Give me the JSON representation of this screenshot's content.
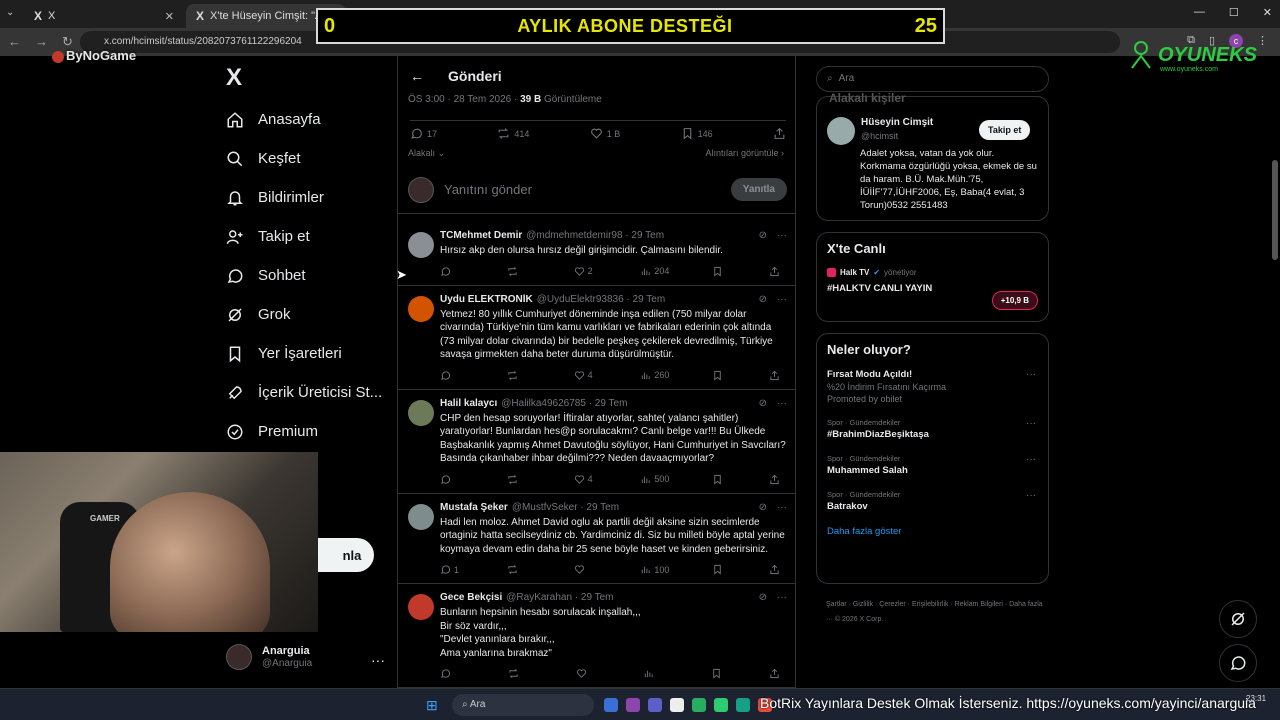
{
  "browser": {
    "tabs": [
      {
        "label": "X",
        "favicon": "X"
      },
      {
        "label": "X'te Hüseyin Cimşit: \"Alın size",
        "favicon": "X"
      }
    ],
    "new_tab": "+",
    "url": "x.com/hcimsit/status/2082073761122296204"
  },
  "overlay": {
    "title": "AYLIK ABONE DESTEĞI",
    "left_count": "0",
    "right_count": "25",
    "brand_left": "ByNoGame",
    "brand_right": "OYUNEKS",
    "brand_right_sub": "www.oyuneks.com"
  },
  "sidebar": {
    "logo": "X",
    "items": [
      {
        "label": "Anasayfa",
        "icon": "home-icon"
      },
      {
        "label": "Keşfet",
        "icon": "search-icon"
      },
      {
        "label": "Bildirimler",
        "icon": "bell-icon"
      },
      {
        "label": "Takip et",
        "icon": "person-add-icon"
      },
      {
        "label": "Sohbet",
        "icon": "chat-icon"
      },
      {
        "label": "Grok",
        "icon": "grok-icon"
      },
      {
        "label": "Yer İşaretleri",
        "icon": "bookmark-icon"
      },
      {
        "label": "İçerik Üreticisi St...",
        "icon": "rocket-icon"
      },
      {
        "label": "Premium",
        "icon": "verified-icon"
      }
    ],
    "post_button": "nla",
    "profile": {
      "name": "Anarguia",
      "handle": "@Anarguia",
      "more": "···"
    }
  },
  "webcam": {
    "label": "GAMER"
  },
  "post": {
    "header": "Gönderi",
    "time": "ÖS 3:00 · 28 Tem 2026 · ",
    "views": "39 B",
    "views_label": " Görüntüleme",
    "stats": {
      "replies": "17",
      "reposts": "414",
      "likes": "1 B",
      "bookmarks": "146"
    },
    "sort": "Alakalı",
    "quotes": "Alıntıları görüntüle ›",
    "reply_placeholder": "Yanıtını gönder",
    "reply_button": "Yanıtla"
  },
  "tweets": [
    {
      "name": "TCMehmet Demir",
      "handle": "@mdmehmetdemir98 · 29 Tem",
      "text": "Hırsız akp den olursa hırsız değil girişimcidir. Çalmasını bilendir.",
      "replies": "",
      "reposts": "",
      "likes": "2",
      "views": "204",
      "avatar": "#8a8f96"
    },
    {
      "name": "Uydu ELEKTRONİK",
      "handle": "@UyduElektr93836 · 29 Tem",
      "text": "Yetmez! 80 yıllık Cumhuriyet döneminde inşa edilen (750 milyar dolar civarında) Türkiye'nin tüm kamu varlıkları ve fabrikaları ederinin çok altında (73 milyar dolar civarında) bir bedelle peşkeş çekilerek devredilmiş, Türkiye savaşa girmekten daha beter duruma düşürülmüştür.",
      "replies": "",
      "reposts": "",
      "likes": "4",
      "views": "260",
      "avatar": "#d35400"
    },
    {
      "name": "Halil kalaycı",
      "handle": "@Halilka49626785 · 29 Tem",
      "text": "CHP den hesap soruyorlar! İftiralar atıyorlar, sahte( yalancı şahitler) yaratıyorlar! Bunlardan hes@p sorulacakmı? Canlı belge var!!! Bu Ülkede Başbakanlık yapmış Ahmet Davutoğlu söylüyor, Hani Cumhuriyet in Savcıları? Basında çıkanhaber ihbar değilmi??? Neden davaaçmıyorlar?",
      "replies": "",
      "reposts": "",
      "likes": "4",
      "views": "500",
      "avatar": "#6d7a5a"
    },
    {
      "name": "Mustafa Şeker",
      "handle": "@MustfvSeker · 29 Tem",
      "text": "Hadi len moloz.  Ahmet David oglu ak partili değil aksine sizin secimlerde ortaginiz hatta secilseydiniz cb. Yardimciniz di.  Siz bu milleti böyle aptal yerine koymaya devam edin daha bir 25 sene böyle haset ve kinden geberirsiniz.",
      "replies": "1",
      "reposts": "",
      "likes": "",
      "views": "100",
      "avatar": "#7f8c8d"
    },
    {
      "name": "Gece Bekçisi",
      "handle": "@RayKarahan · 29 Tem",
      "text": "Bunların hepsinin hesabı sorulacak inşallah,,,\nBir söz vardır,,,\n\"Devlet yanınlara bırakır,,,\nAma yanlarına bırakmaz\"",
      "replies": "",
      "reposts": "",
      "likes": "",
      "views": "",
      "avatar": "#c0392b"
    }
  ],
  "right": {
    "search_placeholder": "Ara",
    "who_title_cut": "Alakalı kişiler",
    "who": {
      "name": "Hüseyin Cimşit",
      "handle": "@hcimsit",
      "follow": "Takip et",
      "bio": "Adalet yoksa, vatan da yok olur. Korkmama özgürlüğü yoksa, ekmek de su da haram. B.Ü. Mak.Müh.'75, İÜİİF'77,İÜHF2006, Eş, Baba(4 evlat, 3 Torun)0532 2551483"
    },
    "live": {
      "title": "X'te Canlı",
      "source": "Halk TV",
      "source_note": "yönetiyor",
      "stream": "#HALKTV CANLI YAYIN",
      "count": "+10,9 B"
    },
    "trends": {
      "title": "Neler oluyor?",
      "items": [
        {
          "cat": "",
          "topic": "Fırsat Modu Açıldı!",
          "sub": "%20 İndirim Fırsatını Kaçırma",
          "promo": "Promoted by obilet"
        },
        {
          "cat": "Spor · Gündemdekiler",
          "topic": "#BrahimDiazBeşiktaşa",
          "sub": "",
          "promo": ""
        },
        {
          "cat": "Spor · Gündemdekiler",
          "topic": "Muhammed Salah",
          "sub": "",
          "promo": ""
        },
        {
          "cat": "Spor · Gündemdekiler",
          "topic": "Batrakov",
          "sub": "",
          "promo": ""
        }
      ],
      "more": "Daha fazla göster"
    },
    "footer": "Şartlar · Gizlilik · Çerezler · Erişilebilirlik · Reklam Bilgileri · Daha fazla ··· © 2026 X Corp."
  },
  "taskbar": {
    "search": "Ara",
    "ticker": "BotRix Yayınlara Destek Olmak İsterseniz. https://oyuneks.com/yayinci/anarguia",
    "time": "23:31"
  }
}
